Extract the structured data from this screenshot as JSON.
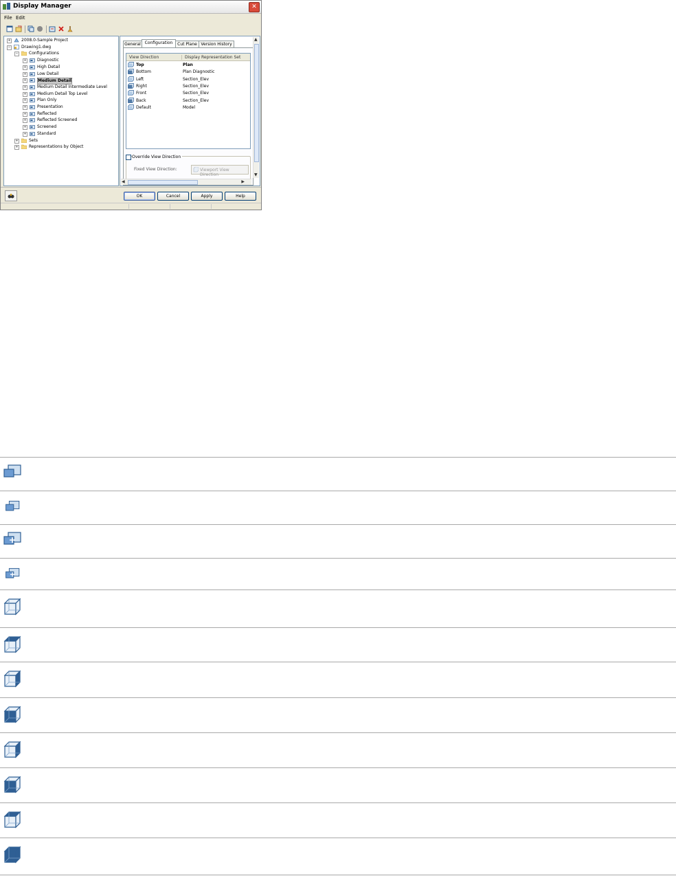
{
  "window": {
    "title": "Display Manager",
    "close_glyph": "✕"
  },
  "menu": {
    "file": "File",
    "edit": "Edit"
  },
  "toolbar_icons": [
    "new-icon",
    "open-icon",
    "copy-icon",
    "purge-icon",
    "import-icon",
    "delete-icon",
    "clean-icon"
  ],
  "tree": {
    "nodes": [
      {
        "label": "2008.0-Sample Project",
        "icon": "project-icon"
      },
      {
        "label": "Drawing1.dwg",
        "icon": "drawing-icon"
      },
      {
        "label": "Configurations",
        "icon": "folder-icon"
      },
      {
        "label": "Diagnostic",
        "icon": "config-icon"
      },
      {
        "label": "High Detail",
        "icon": "config-icon"
      },
      {
        "label": "Low Detail",
        "icon": "config-icon"
      },
      {
        "label": "Medium Detail",
        "icon": "config-icon",
        "selected": true
      },
      {
        "label": "Medium Detail Intermediate Level",
        "icon": "config-icon"
      },
      {
        "label": "Medium Detail Top Level",
        "icon": "config-icon"
      },
      {
        "label": "Plan Only",
        "icon": "config-icon"
      },
      {
        "label": "Presentation",
        "icon": "config-icon"
      },
      {
        "label": "Reflected",
        "icon": "config-icon"
      },
      {
        "label": "Reflected Screened",
        "icon": "config-icon"
      },
      {
        "label": "Screened",
        "icon": "config-icon"
      },
      {
        "label": "Standard",
        "icon": "config-icon"
      },
      {
        "label": "Sets",
        "icon": "folder-icon"
      },
      {
        "label": "Representations by Object",
        "icon": "folder-icon"
      }
    ]
  },
  "tabs": [
    "General",
    "Configuration",
    "Cut Plane",
    "Version History"
  ],
  "active_tab": "Configuration",
  "table": {
    "headers": [
      "View Direction",
      "Display Representation Set"
    ],
    "rows": [
      {
        "direction": "Top",
        "set": "Plan"
      },
      {
        "direction": "Bottom",
        "set": "Plan Diagnostic"
      },
      {
        "direction": "Left",
        "set": "Section_Elev"
      },
      {
        "direction": "Right",
        "set": "Section_Elev"
      },
      {
        "direction": "Front",
        "set": "Section_Elev"
      },
      {
        "direction": "Back",
        "set": "Section_Elev"
      },
      {
        "direction": "Default",
        "set": "Model"
      }
    ]
  },
  "override": {
    "checkbox_label": "Override View Direction",
    "checked": false,
    "fixed_label": "Fixed View Direction:",
    "dropdown_value": "Viewport View Direction"
  },
  "buttons": {
    "ok": "OK",
    "cancel": "Cancel",
    "apply": "Apply",
    "help": "Help"
  },
  "legend_icons": [
    "config-view-icon",
    "config-view-small-icon",
    "config-edit-icon",
    "config-edit-small-icon",
    "default-view-cube-icon",
    "top-view-cube-icon",
    "bottom-view-cube-icon",
    "left-view-cube-icon",
    "right-view-cube-icon",
    "front-view-cube-icon",
    "back-view-cube-icon",
    "model-view-cube-icon"
  ],
  "colors": {
    "accent_blue": "#3a6ea5",
    "cube_light": "#dce8f4",
    "cube_dark": "#2f5f94",
    "selection": "#c8c8c8"
  }
}
